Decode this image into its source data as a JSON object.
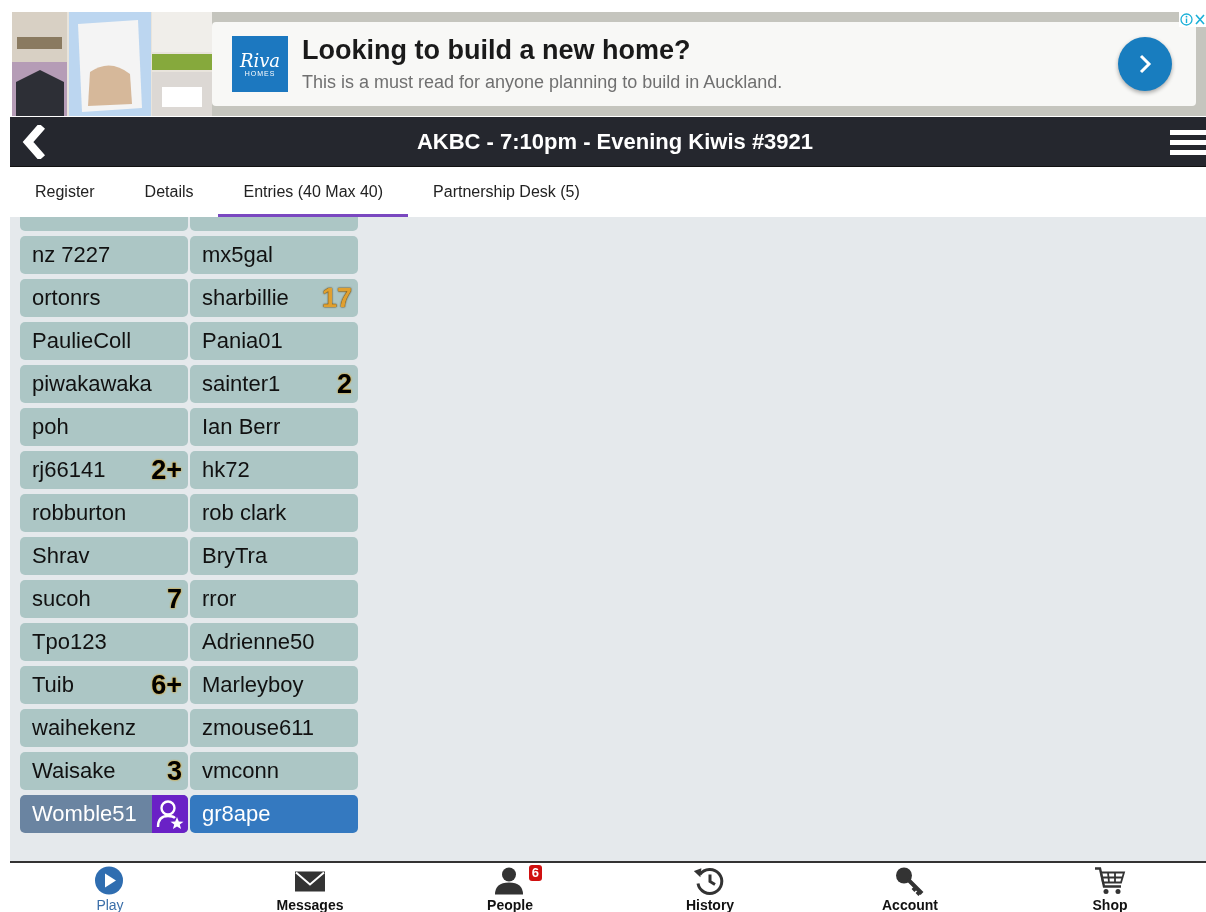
{
  "ad": {
    "logo": {
      "script": "Riva",
      "sub": "HOMES"
    },
    "headline": "Looking to build a new home?",
    "text": "This is a must read for anyone planning to build in Auckland."
  },
  "header": {
    "title": "AKBC - 7:10pm - Evening Kiwis #3921"
  },
  "tabs": [
    {
      "label": "Register",
      "selected": false
    },
    {
      "label": "Details",
      "selected": false
    },
    {
      "label": "Entries (40 Max 40)",
      "selected": true
    },
    {
      "label": "Partnership Desk (5)",
      "selected": false
    }
  ],
  "pairs": [
    {
      "players": [
        {
          "kind": "normal"
        },
        {
          "kind": "normal"
        }
      ]
    },
    {
      "players": [
        {
          "name": "nz 7227",
          "kind": "normal"
        },
        {
          "name": "mx5gal",
          "kind": "normal"
        }
      ]
    },
    {
      "players": [
        {
          "name": "ortonrs",
          "kind": "normal"
        },
        {
          "name": "sharbillie",
          "kind": "normal",
          "badge": {
            "text": "17",
            "kind": "gold"
          }
        }
      ]
    },
    {
      "players": [
        {
          "name": "PaulieColl",
          "kind": "normal"
        },
        {
          "name": "Pania01",
          "kind": "normal"
        }
      ]
    },
    {
      "players": [
        {
          "name": "piwakawaka",
          "kind": "normal"
        },
        {
          "name": "sainter1",
          "kind": "normal",
          "badge": {
            "text": "2",
            "kind": "black"
          }
        }
      ]
    },
    {
      "players": [
        {
          "name": "poh",
          "kind": "normal"
        },
        {
          "name": "Ian Berr",
          "kind": "normal"
        }
      ]
    },
    {
      "players": [
        {
          "name": "rj66141",
          "kind": "normal",
          "badge": {
            "text": "2+",
            "kind": "black"
          }
        },
        {
          "name": "hk72",
          "kind": "normal"
        }
      ]
    },
    {
      "players": [
        {
          "name": "robburton",
          "kind": "normal"
        },
        {
          "name": "rob clark",
          "kind": "normal"
        }
      ]
    },
    {
      "players": [
        {
          "name": "Shrav",
          "kind": "normal"
        },
        {
          "name": "BryTra",
          "kind": "normal"
        }
      ]
    },
    {
      "players": [
        {
          "name": "sucoh",
          "kind": "normal",
          "badge": {
            "text": "7",
            "kind": "black"
          }
        },
        {
          "name": "rror",
          "kind": "normal"
        }
      ]
    },
    {
      "players": [
        {
          "name": "Tpo123",
          "kind": "normal"
        },
        {
          "name": "Adrienne50",
          "kind": "normal"
        }
      ]
    },
    {
      "players": [
        {
          "name": "Tuib",
          "kind": "normal",
          "badge": {
            "text": "6+",
            "kind": "black"
          }
        },
        {
          "name": "Marleyboy",
          "kind": "normal"
        }
      ]
    },
    {
      "players": [
        {
          "name": "waihekenz",
          "kind": "normal"
        },
        {
          "name": "zmouse611",
          "kind": "normal"
        }
      ]
    },
    {
      "players": [
        {
          "name": "Waisake",
          "kind": "normal",
          "badge": {
            "text": "3",
            "kind": "black"
          }
        },
        {
          "name": "vmconn",
          "kind": "normal"
        }
      ]
    },
    {
      "players": [
        {
          "name": "Womble51",
          "kind": "self"
        },
        {
          "name": "gr8ape",
          "kind": "partner"
        }
      ]
    }
  ],
  "bottom_nav": [
    {
      "label": "Play",
      "kind": "play",
      "selected": true
    },
    {
      "label": "Messages",
      "kind": "mail",
      "selected": false
    },
    {
      "label": "People",
      "kind": "person",
      "selected": false,
      "badge": "6"
    },
    {
      "label": "History",
      "kind": "history",
      "selected": false
    },
    {
      "label": "Account",
      "kind": "key",
      "selected": false
    },
    {
      "label": "Shop",
      "kind": "cart",
      "selected": false
    }
  ]
}
